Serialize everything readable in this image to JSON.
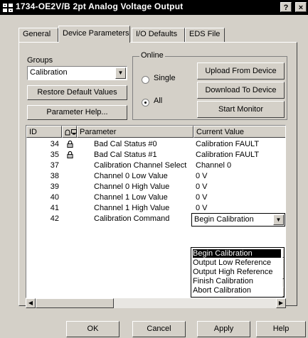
{
  "window": {
    "title": "1734-OE2V/B 2pt Analog Voltage Output",
    "help_button": "?",
    "close_button": "×"
  },
  "tabs": [
    {
      "label": "General",
      "active": false
    },
    {
      "label": "Device Parameters",
      "active": true
    },
    {
      "label": "I/O Defaults",
      "active": false
    },
    {
      "label": "EDS File",
      "active": false
    }
  ],
  "groups": {
    "label": "Groups",
    "selected": "Calibration"
  },
  "buttons": {
    "restore_defaults": "Restore Default Values",
    "parameter_help": "Parameter Help...",
    "upload": "Upload From Device",
    "download": "Download To Device",
    "start_monitor": "Start Monitor"
  },
  "online": {
    "label": "Online",
    "options": [
      {
        "label": "Single",
        "selected": false
      },
      {
        "label": "All",
        "selected": true
      }
    ]
  },
  "table": {
    "columns": {
      "id": "ID",
      "parameter": "Parameter",
      "value": "Current Value"
    },
    "rows": [
      {
        "id": "34",
        "locked": true,
        "parameter": "Bad Cal Status #0",
        "value": "Calibration FAULT"
      },
      {
        "id": "35",
        "locked": true,
        "parameter": "Bad Cal Status #1",
        "value": "Calibration FAULT"
      },
      {
        "id": "37",
        "locked": false,
        "parameter": "Calibration Channel Select",
        "value": "Channel 0"
      },
      {
        "id": "38",
        "locked": false,
        "parameter": "Channel 0 Low Value",
        "value": "0 V"
      },
      {
        "id": "39",
        "locked": false,
        "parameter": "Channel 0 High Value",
        "value": "0 V"
      },
      {
        "id": "40",
        "locked": false,
        "parameter": "Channel 1 Low Value",
        "value": "0 V"
      },
      {
        "id": "41",
        "locked": false,
        "parameter": "Channel 1 High Value",
        "value": "0 V"
      },
      {
        "id": "42",
        "locked": false,
        "parameter": "Calibration Command",
        "value": "Begin Calibration"
      }
    ]
  },
  "dropdown": {
    "options": [
      "Begin Calibration",
      "Output Low Reference",
      "Output High Reference",
      "Finish Calibration",
      "Abort Calibration"
    ],
    "selected_index": 0
  },
  "footer": {
    "ok": "OK",
    "cancel": "Cancel",
    "apply": "Apply",
    "help": "Help"
  },
  "colors": {
    "dialog_bg": "#d4d0c8",
    "titlebar_bg": "#000000",
    "selection_bg": "#000000"
  }
}
